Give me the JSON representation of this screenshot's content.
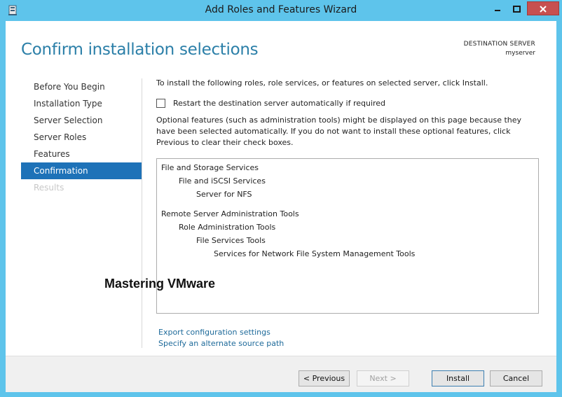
{
  "window": {
    "title": "Add Roles and Features Wizard"
  },
  "header": {
    "title": "Confirm installation selections",
    "destination_label": "DESTINATION SERVER",
    "destination_name": "myserver"
  },
  "nav": {
    "items": [
      {
        "label": "Before You Begin"
      },
      {
        "label": "Installation Type"
      },
      {
        "label": "Server Selection"
      },
      {
        "label": "Server Roles"
      },
      {
        "label": "Features"
      },
      {
        "label": "Confirmation"
      },
      {
        "label": "Results"
      }
    ]
  },
  "content": {
    "intro": "To install the following roles, role services, or features on selected server, click Install.",
    "restart_label": "Restart the destination server automatically if required",
    "optional_text": "Optional features (such as administration tools) might be displayed on this page because they have been selected automatically. If you do not want to install these optional features, click Previous to clear their check boxes.",
    "features": [
      {
        "label": "File and Storage Services"
      },
      {
        "label": "File and iSCSI Services"
      },
      {
        "label": "Server for NFS"
      },
      {
        "label": "Remote Server Administration Tools"
      },
      {
        "label": "Role Administration Tools"
      },
      {
        "label": "File Services Tools"
      },
      {
        "label": "Services for Network File System Management Tools"
      }
    ],
    "export_link": "Export configuration settings",
    "alternate_link": "Specify an alternate source path"
  },
  "watermark": "Mastering VMware",
  "footer": {
    "previous": "< Previous",
    "next": "Next >",
    "install": "Install",
    "cancel": "Cancel"
  },
  "colors": {
    "titlebar": "#5ec4eb",
    "accent": "#2b7fa8",
    "nav_active": "#1e72b8",
    "close_button": "#c75050",
    "link": "#1e6a9a"
  },
  "icons": {
    "app": "server-manager-icon",
    "minimize": "minimize-icon",
    "maximize": "maximize-icon",
    "close": "close-icon"
  }
}
